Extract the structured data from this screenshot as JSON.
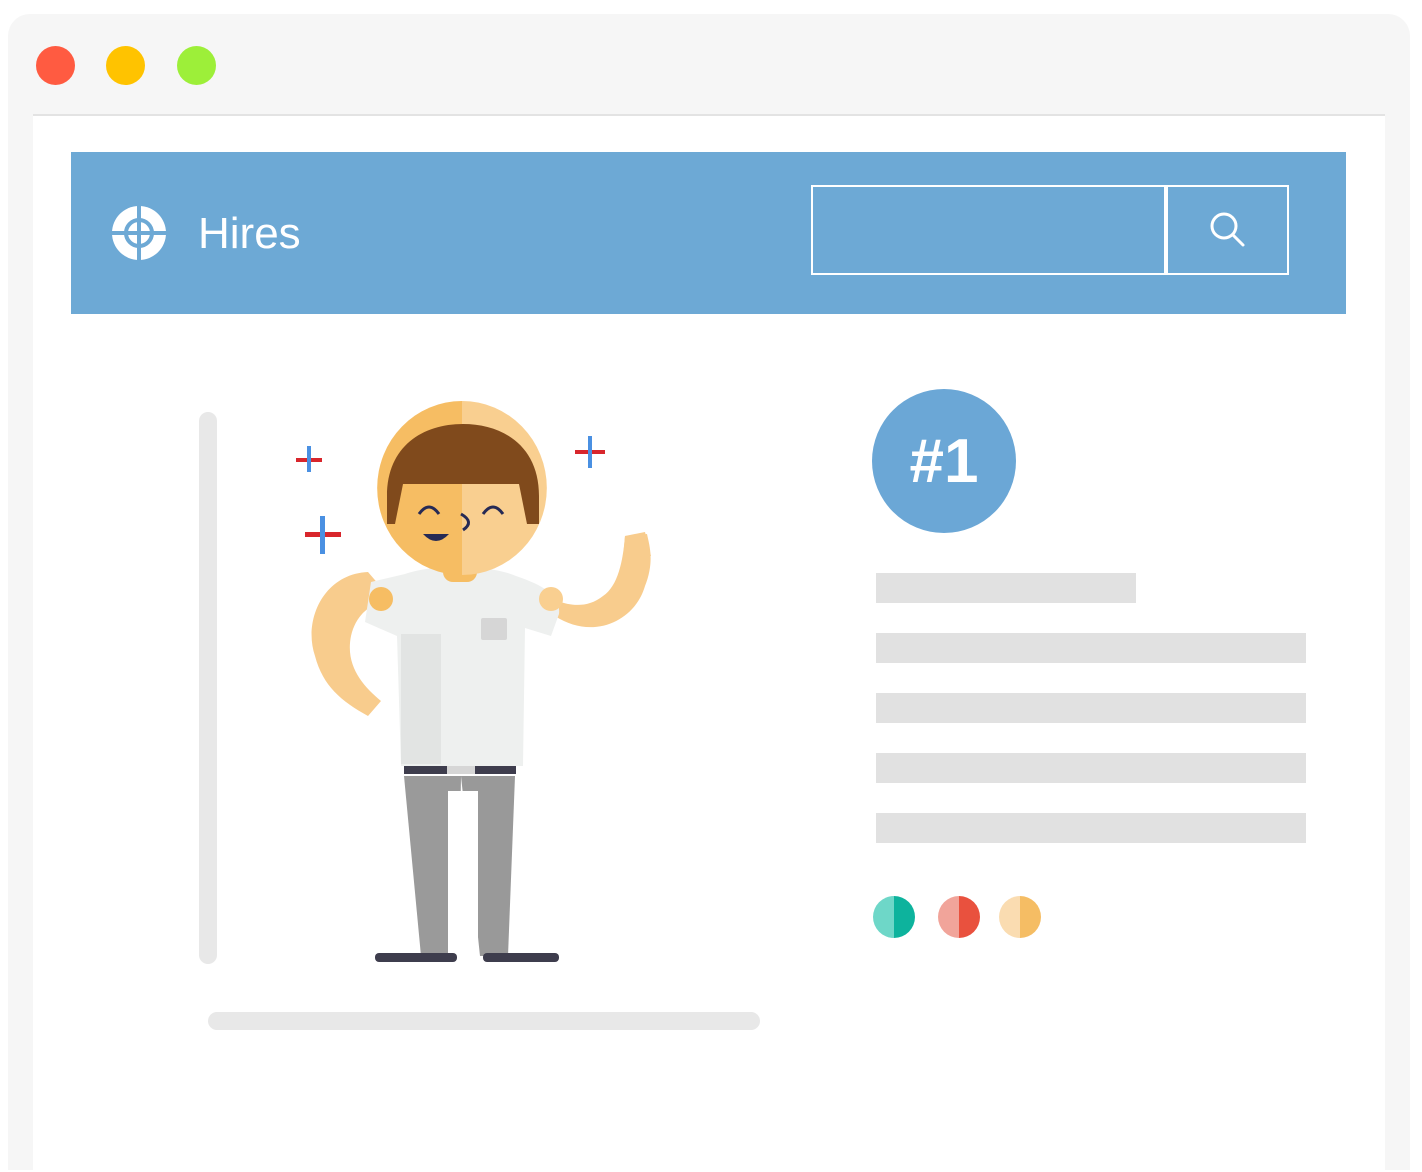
{
  "window": {
    "controls": [
      "close",
      "minimize",
      "maximize"
    ]
  },
  "header": {
    "brand": "Hires",
    "logo_icon": "crosshair-globe-icon",
    "search": {
      "placeholder": "",
      "value": "",
      "button_icon": "search-icon"
    }
  },
  "profile": {
    "rank": "#1",
    "dots": [
      "teal",
      "coral",
      "sand"
    ]
  },
  "colors": {
    "header": "#6da9d5",
    "badge": "#6ba7d6",
    "placeholder": "#e1e1e1",
    "teal": "#0db39d",
    "coral": "#e9513e",
    "sand": "#f5bd64"
  }
}
